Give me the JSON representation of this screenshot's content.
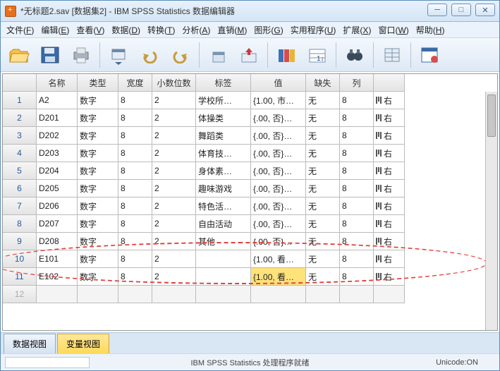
{
  "title": "*无标题2.sav [数据集2] - IBM SPSS Statistics 数据编辑器",
  "menus": [
    "文件(F)",
    "编辑(E)",
    "查看(V)",
    "数据(D)",
    "转换(T)",
    "分析(A)",
    "直销(M)",
    "图形(G)",
    "实用程序(U)",
    "扩展(X)",
    "窗口(W)",
    "帮助(H)"
  ],
  "columns": [
    "名称",
    "类型",
    "宽度",
    "小数位数",
    "标签",
    "值",
    "缺失",
    "列",
    ""
  ],
  "rows": [
    {
      "n": "1",
      "name": "A2",
      "type": "数字",
      "w": "8",
      "d": "2",
      "lbl": "学校所…",
      "val": "{1.00, 市…",
      "miss": "无",
      "col": "8"
    },
    {
      "n": "2",
      "name": "D201",
      "type": "数字",
      "w": "8",
      "d": "2",
      "lbl": "体操类",
      "val": "{.00, 否}…",
      "miss": "无",
      "col": "8"
    },
    {
      "n": "3",
      "name": "D202",
      "type": "数字",
      "w": "8",
      "d": "2",
      "lbl": "舞蹈类",
      "val": "{.00, 否}…",
      "miss": "无",
      "col": "8"
    },
    {
      "n": "4",
      "name": "D203",
      "type": "数字",
      "w": "8",
      "d": "2",
      "lbl": "体育技…",
      "val": "{.00, 否}…",
      "miss": "无",
      "col": "8"
    },
    {
      "n": "5",
      "name": "D204",
      "type": "数字",
      "w": "8",
      "d": "2",
      "lbl": "身体素…",
      "val": "{.00, 否}…",
      "miss": "无",
      "col": "8"
    },
    {
      "n": "6",
      "name": "D205",
      "type": "数字",
      "w": "8",
      "d": "2",
      "lbl": "趣味游戏",
      "val": "{.00, 否}…",
      "miss": "无",
      "col": "8"
    },
    {
      "n": "7",
      "name": "D206",
      "type": "数字",
      "w": "8",
      "d": "2",
      "lbl": "特色活…",
      "val": "{.00, 否}…",
      "miss": "无",
      "col": "8"
    },
    {
      "n": "8",
      "name": "D207",
      "type": "数字",
      "w": "8",
      "d": "2",
      "lbl": "自由活动",
      "val": "{.00, 否}…",
      "miss": "无",
      "col": "8"
    },
    {
      "n": "9",
      "name": "D208",
      "type": "数字",
      "w": "8",
      "d": "2",
      "lbl": "其他",
      "val": "{.00, 否}…",
      "miss": "无",
      "col": "8"
    },
    {
      "n": "10",
      "name": "E101",
      "type": "数字",
      "w": "8",
      "d": "2",
      "lbl": "",
      "val": "{1.00, 看…",
      "miss": "无",
      "col": "8"
    },
    {
      "n": "11",
      "name": "E102",
      "type": "数字",
      "w": "8",
      "d": "2",
      "lbl": "",
      "val": "{1.00, 看…",
      "miss": "无",
      "col": "8",
      "hl": true
    },
    {
      "n": "12",
      "name": "",
      "type": "",
      "w": "",
      "d": "",
      "lbl": "",
      "val": "",
      "miss": "",
      "col": "",
      "empty": true
    }
  ],
  "tabs": {
    "data": "数据视图",
    "var": "变量视图"
  },
  "status": {
    "center": "IBM SPSS Statistics 处理程序就绪",
    "right": "Unicode:ON"
  },
  "align_text": "右"
}
